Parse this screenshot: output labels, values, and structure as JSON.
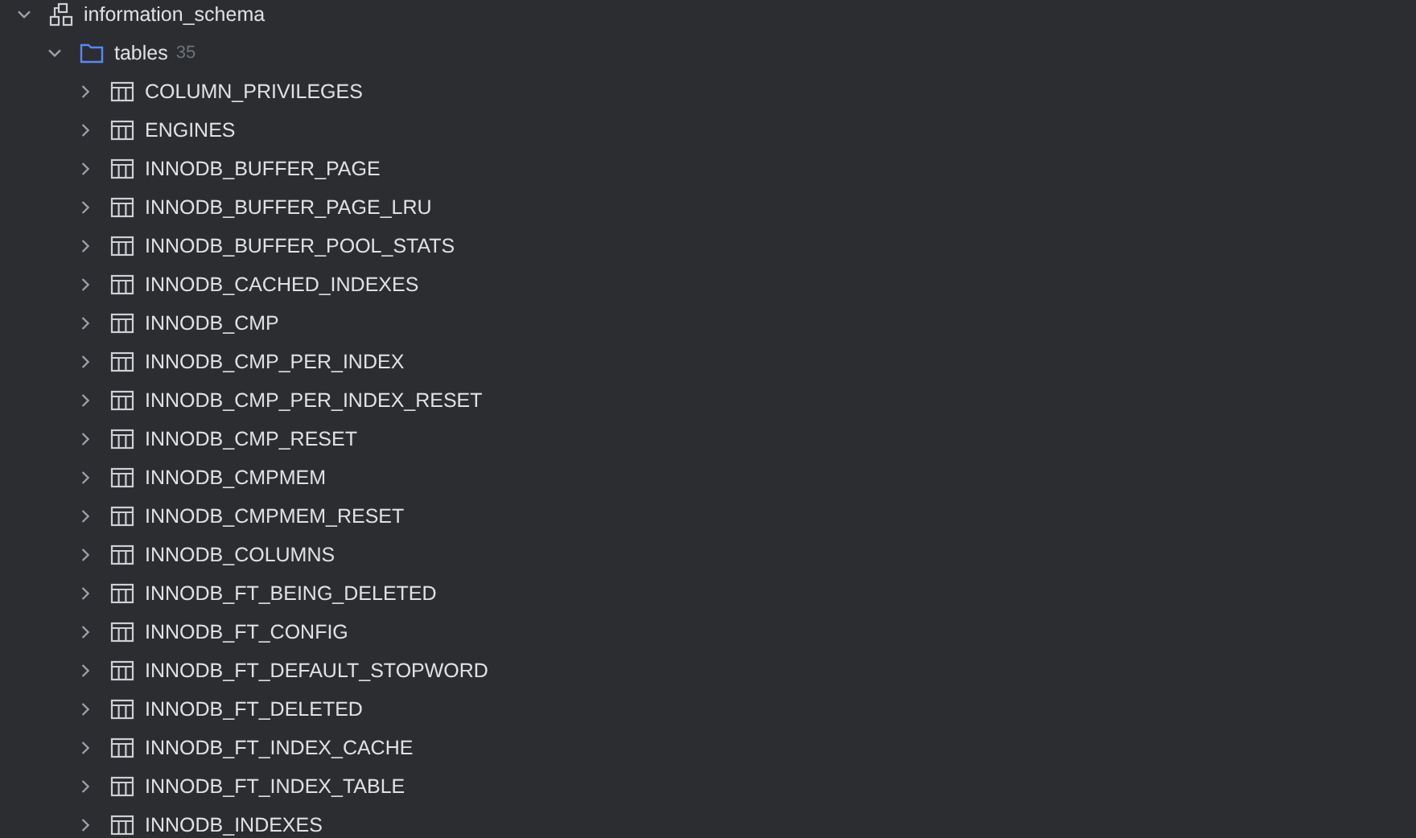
{
  "tree": [
    {
      "kind": "schema",
      "label": "information_schema",
      "expanded": true,
      "children": [
        {
          "kind": "folder",
          "label": "tables",
          "count": "35",
          "expanded": true,
          "children": [
            {
              "kind": "table",
              "label": "COLUMN_PRIVILEGES",
              "expanded": false
            },
            {
              "kind": "table",
              "label": "ENGINES",
              "expanded": false
            },
            {
              "kind": "table",
              "label": "INNODB_BUFFER_PAGE",
              "expanded": false
            },
            {
              "kind": "table",
              "label": "INNODB_BUFFER_PAGE_LRU",
              "expanded": false
            },
            {
              "kind": "table",
              "label": "INNODB_BUFFER_POOL_STATS",
              "expanded": false
            },
            {
              "kind": "table",
              "label": "INNODB_CACHED_INDEXES",
              "expanded": false
            },
            {
              "kind": "table",
              "label": "INNODB_CMP",
              "expanded": false
            },
            {
              "kind": "table",
              "label": "INNODB_CMP_PER_INDEX",
              "expanded": false
            },
            {
              "kind": "table",
              "label": "INNODB_CMP_PER_INDEX_RESET",
              "expanded": false
            },
            {
              "kind": "table",
              "label": "INNODB_CMP_RESET",
              "expanded": false
            },
            {
              "kind": "table",
              "label": "INNODB_CMPMEM",
              "expanded": false
            },
            {
              "kind": "table",
              "label": "INNODB_CMPMEM_RESET",
              "expanded": false
            },
            {
              "kind": "table",
              "label": "INNODB_COLUMNS",
              "expanded": false
            },
            {
              "kind": "table",
              "label": "INNODB_FT_BEING_DELETED",
              "expanded": false
            },
            {
              "kind": "table",
              "label": "INNODB_FT_CONFIG",
              "expanded": false
            },
            {
              "kind": "table",
              "label": "INNODB_FT_DEFAULT_STOPWORD",
              "expanded": false
            },
            {
              "kind": "table",
              "label": "INNODB_FT_DELETED",
              "expanded": false
            },
            {
              "kind": "table",
              "label": "INNODB_FT_INDEX_CACHE",
              "expanded": false
            },
            {
              "kind": "table",
              "label": "INNODB_FT_INDEX_TABLE",
              "expanded": false
            },
            {
              "kind": "table",
              "label": "INNODB_INDEXES",
              "expanded": false
            }
          ]
        }
      ]
    }
  ]
}
